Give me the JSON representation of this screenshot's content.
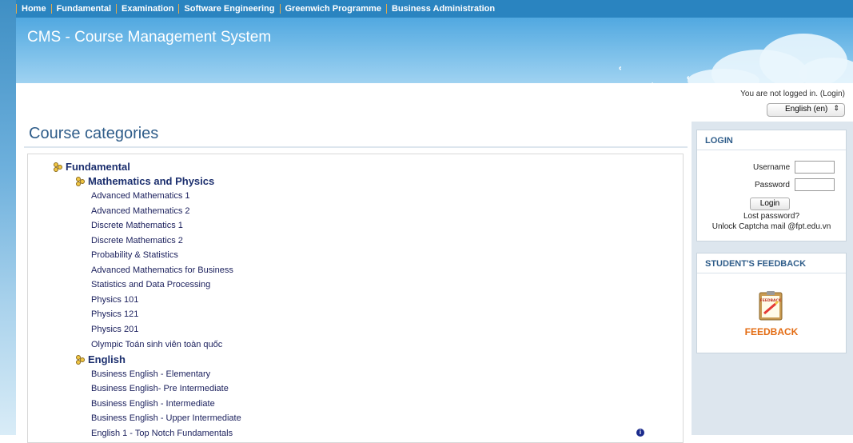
{
  "nav": {
    "items": [
      "Home",
      "Fundamental",
      "Examination",
      "Software Engineering",
      "Greenwich Programme",
      "Business Administration"
    ]
  },
  "banner": {
    "title": "CMS - Course Management System"
  },
  "header": {
    "login_text": "You are not logged in. (",
    "login_link": "Login",
    "login_close": ")",
    "language": "English (en)"
  },
  "main": {
    "title": "Course categories",
    "categories": [
      {
        "name": "Fundamental",
        "level": 1
      },
      {
        "name": "Mathematics and Physics",
        "level": 2
      },
      {
        "name": "English",
        "level": 2
      }
    ],
    "math_courses": [
      "Advanced Mathematics 1",
      "Advanced Mathematics 2",
      "Discrete Mathematics 1",
      "Discrete Mathematics 2",
      "Probability & Statistics",
      "Advanced Mathematics for Business",
      "Statistics and Data Processing",
      "Physics 101",
      "Physics 121",
      "Physics 201",
      "Olympic Toán sinh viên toàn quốc"
    ],
    "english_courses": [
      "Business English - Elementary",
      "Business English- Pre Intermediate",
      "Business English - Intermediate",
      "Business English - Upper Intermediate",
      "English 1 - Top Notch Fundamentals"
    ]
  },
  "login_block": {
    "title": "LOGIN",
    "username_label": "Username",
    "password_label": "Password",
    "button": "Login",
    "lost_password": "Lost password?",
    "unlock": "Unlock Captcha mail @fpt.edu.vn"
  },
  "feedback_block": {
    "title": "STUDENT'S FEEDBACK",
    "label": "FEEDBACK",
    "image_text": "FEEDBACK"
  },
  "colors": {
    "nav": "#2a84c0",
    "accent_orange": "#e36b12",
    "title_blue": "#2f5d8a"
  }
}
